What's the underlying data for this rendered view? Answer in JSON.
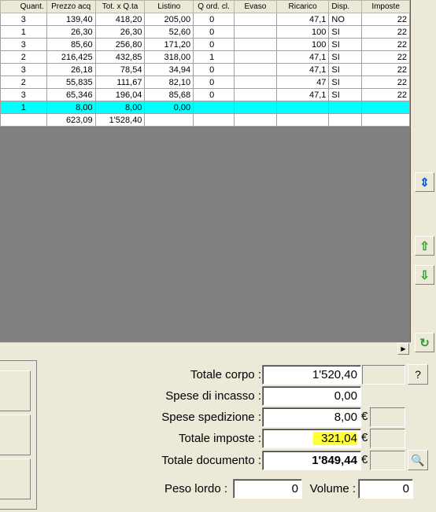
{
  "grid": {
    "columns": [
      "Quant.",
      "Prezzo acq",
      "Tot. x Q.ta",
      "Listino",
      "Q ord. cl.",
      "Evaso",
      "Ricarico",
      "Disp.",
      "Imposte"
    ],
    "rows": [
      {
        "quant": "3",
        "prezzo": "139,40",
        "tot": "418,20",
        "listino": "205,00",
        "qord": "0",
        "evaso": "",
        "ricarico": "47,1",
        "disp": "NO",
        "imposte": "22"
      },
      {
        "quant": "1",
        "prezzo": "26,30",
        "tot": "26,30",
        "listino": "52,60",
        "qord": "0",
        "evaso": "",
        "ricarico": "100",
        "disp": "SI",
        "imposte": "22"
      },
      {
        "quant": "3",
        "prezzo": "85,60",
        "tot": "256,80",
        "listino": "171,20",
        "qord": "0",
        "evaso": "",
        "ricarico": "100",
        "disp": "SI",
        "imposte": "22"
      },
      {
        "quant": "2",
        "prezzo": "216,425",
        "tot": "432,85",
        "listino": "318,00",
        "qord": "1",
        "evaso": "",
        "ricarico": "47,1",
        "disp": "SI",
        "imposte": "22"
      },
      {
        "quant": "3",
        "prezzo": "26,18",
        "tot": "78,54",
        "listino": "34,94",
        "qord": "0",
        "evaso": "",
        "ricarico": "47,1",
        "disp": "SI",
        "imposte": "22"
      },
      {
        "quant": "2",
        "prezzo": "55,835",
        "tot": "111,67",
        "listino": "82,10",
        "qord": "0",
        "evaso": "",
        "ricarico": "47",
        "disp": "SI",
        "imposte": "22"
      },
      {
        "quant": "3",
        "prezzo": "65,346",
        "tot": "196,04",
        "listino": "85,68",
        "qord": "0",
        "evaso": "",
        "ricarico": "47,1",
        "disp": "SI",
        "imposte": "22"
      },
      {
        "quant": "1",
        "prezzo": "8,00",
        "tot": "8,00",
        "listino": "0,00",
        "qord": "",
        "evaso": "",
        "ricarico": "",
        "disp": "",
        "imposte": ""
      }
    ],
    "selected_row_index": 7,
    "totals": {
      "prezzo": "623,09",
      "tot": "1'528,40"
    }
  },
  "totals": {
    "corpo_label": "Totale corpo :",
    "corpo_value": "1'520,40",
    "incasso_label": "Spese di incasso :",
    "incasso_value": "0,00",
    "spedizione_label": "Spese spedizione :",
    "spedizione_value": "8,00",
    "imposte_label": "Totale imposte :",
    "imposte_value": "321,04",
    "documento_label": "Totale documento :",
    "documento_value": "1'849,44",
    "currency": "€",
    "help_button": "?",
    "peso_label": "Peso lordo :",
    "peso_value": "0",
    "volume_label": "Volume :",
    "volume_value": "0"
  },
  "colors": {
    "selected_row": "#00ffff",
    "highlight": "#ffff3a",
    "grid_background": "#808080"
  },
  "icons": {
    "side_sort": "sort-arrows-icon",
    "side_up": "arrow-up-icon",
    "side_down": "arrow-down-icon",
    "side_refresh": "refresh-icon",
    "scroll_right": "scroll-right-icon",
    "zoom": "zoom-icon"
  }
}
